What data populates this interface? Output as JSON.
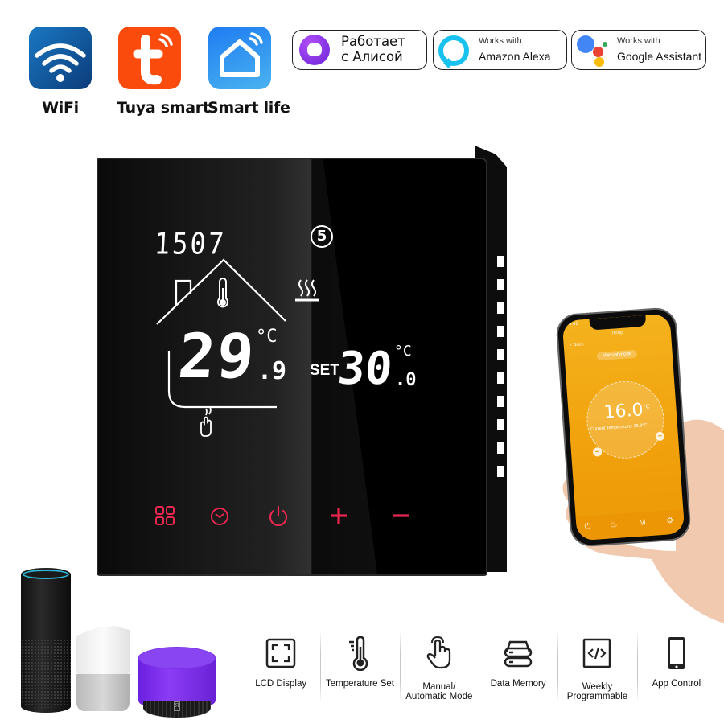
{
  "apps": [
    {
      "label": "WiFi",
      "icon": "wifi-icon",
      "color": "#0f5aa3"
    },
    {
      "label": "Tuya smart",
      "icon": "tuya-logo-icon",
      "color": "#fa4b0d"
    },
    {
      "label": "Smart life",
      "icon": "smart-life-house-icon",
      "color": "#2d8ef0"
    }
  ],
  "badges": {
    "alice": {
      "line1": "Работает",
      "line2": "с Алисой",
      "icon": "alice-logo-icon"
    },
    "alexa": {
      "small": "Works with",
      "big": "Amazon Alexa",
      "icon": "alexa-logo-icon"
    },
    "google": {
      "small": "Works with",
      "big": "Google Assistant",
      "icon": "google-assistant-logo-icon"
    }
  },
  "thermostat": {
    "clock": "1507",
    "program": "5",
    "current_temp_int": "29",
    "current_temp_dec": ".9",
    "current_unit": "°C",
    "set_label": "SET",
    "set_temp_int": "30",
    "set_temp_dec": ".0",
    "set_unit": "°C",
    "icons": [
      "house-icon",
      "thermometer-icon",
      "heating-icon",
      "manual-hand-icon"
    ],
    "buttons": [
      {
        "name": "menu-button",
        "icon": "grid-icon"
      },
      {
        "name": "clock-button",
        "icon": "clock-icon"
      },
      {
        "name": "power-button",
        "icon": "power-icon"
      },
      {
        "name": "plus-button",
        "icon": "plus-icon"
      },
      {
        "name": "minus-button",
        "icon": "minus-icon"
      }
    ],
    "button_color": "#e8264f"
  },
  "phone": {
    "status_time": "9:41",
    "title": "Temp",
    "back": "‹ Back",
    "mode": "Manual mode",
    "set_temp": "16.0",
    "set_unit": "°C",
    "current_text": "Current Temperature: 28.9°C",
    "minus": "−",
    "plus": "+",
    "tabs": [
      "⏻",
      "♨",
      "M",
      "⚙"
    ],
    "accent": "#f1a10b"
  },
  "speakers": [
    "amazon-echo",
    "google-home",
    "yandex-station"
  ],
  "features": [
    {
      "label": "LCD Display",
      "icon": "lcd-display-icon"
    },
    {
      "label": "Temperature Set",
      "icon": "temperature-set-icon"
    },
    {
      "label": "Manual/\nAutomatic Mode",
      "line1": "Manual/",
      "line2": "Automatic Mode",
      "icon": "touch-hand-icon"
    },
    {
      "label": "Data Memory",
      "icon": "data-memory-icon"
    },
    {
      "label": "Weekly\nProgrammable",
      "line1": "Weekly",
      "line2": "Programmable",
      "icon": "code-icon"
    },
    {
      "label": "App Control",
      "icon": "smartphone-icon"
    }
  ]
}
